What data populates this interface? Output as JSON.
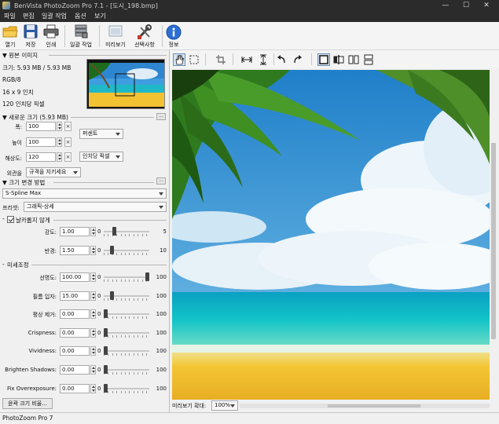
{
  "window": {
    "title": "BenVista PhotoZoom Pro 7.1 - [도시_198.bmp]",
    "minimize": "—",
    "maximize": "☐",
    "close": "✕"
  },
  "menu": [
    "파일",
    "편집",
    "일괄 작업",
    "옵션",
    "보기"
  ],
  "toolbar": {
    "open": "열기",
    "save": "저장",
    "print": "인쇄",
    "batch": "일괄 작업",
    "preview": "미리보기",
    "preferences": "선택사항",
    "about": "정보"
  },
  "original": {
    "header": "▼ 원본 이미지",
    "size": "크기: 5.93 MB / 5.93 MB",
    "mode": "RGB/8",
    "dimensions": "16 x 9 인치",
    "resolution": "120 인치당 픽셀"
  },
  "newsize": {
    "header": "▼ 새로운 크기 (5.93 MB)",
    "width_label": "폭:",
    "width_value": "100",
    "height_label": "높이",
    "height_value": "100",
    "unit": "퍼센트",
    "res_label": "해상도:",
    "res_value": "120",
    "res_unit": "인치당 픽셀",
    "aspect_label": "외관을",
    "aspect_value": "규격을 지키세요"
  },
  "method": {
    "header": "▼ 크기 변경 방법",
    "algorithm": "S-Spline Max",
    "preset_label": "프리셋:",
    "preset_value": "그래픽-상세"
  },
  "unsharp": {
    "header": "날카롭지 않게",
    "toggle": "-",
    "checked": true,
    "rows": [
      {
        "label": "강도:",
        "value": "1.00",
        "min": "0",
        "max": "5",
        "level": 0.2
      },
      {
        "label": "반경:",
        "value": "1.50",
        "min": "0",
        "max": "10",
        "level": 0.15
      }
    ]
  },
  "finetune": {
    "header": "미세조정",
    "toggle": "-",
    "rows": [
      {
        "label": "선명도:",
        "value": "100.00",
        "min": "0",
        "max": "100",
        "level": 1.0
      },
      {
        "label": "필름 입자:",
        "value": "15.00",
        "min": "0",
        "max": "100",
        "level": 0.15
      },
      {
        "label": "평상 제거:",
        "value": "0.00",
        "min": "0",
        "max": "100",
        "level": 0.0
      },
      {
        "label": "Crispness:",
        "value": "0.00",
        "min": "0",
        "max": "100",
        "level": 0.0
      },
      {
        "label": "Vividness:",
        "value": "0.00",
        "min": "0",
        "max": "100",
        "level": 0.0
      },
      {
        "label": "Brighten Shadows:",
        "value": "0.00",
        "min": "0",
        "max": "100",
        "level": 0.0
      },
      {
        "label": "Fix Overexposure:",
        "value": "0.00",
        "min": "0",
        "max": "100",
        "level": 0.0
      }
    ]
  },
  "bottom_button": "윤곽 크기 비율...",
  "preview_zoom_label": "미리보기 확대:",
  "preview_zoom_value": "100%",
  "status": "PhotoZoom Pro 7"
}
